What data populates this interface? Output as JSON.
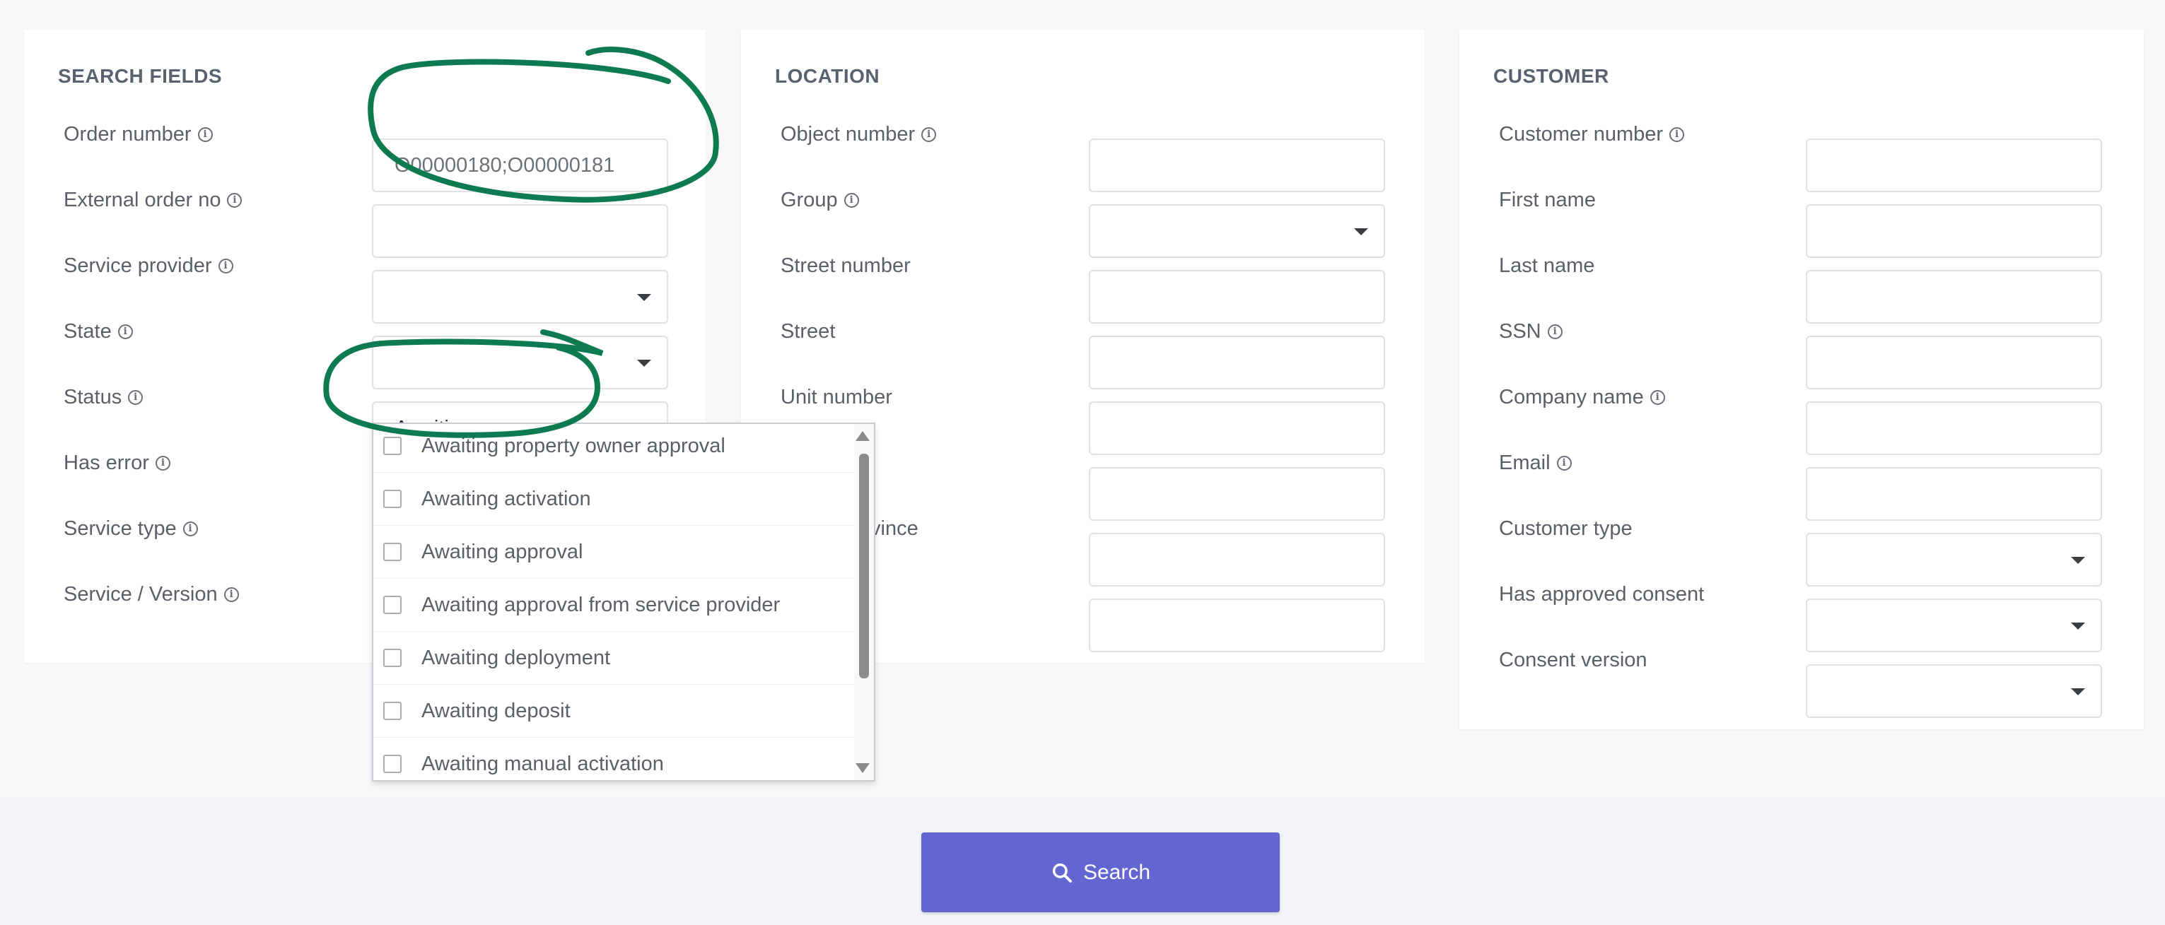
{
  "search_fields": {
    "title": "SEARCH FIELDS",
    "rows": [
      {
        "label": "Order number",
        "value": "O00000180;O00000181"
      },
      {
        "label": "External order no",
        "value": ""
      },
      {
        "label": "Service provider",
        "value": ""
      },
      {
        "label": "State",
        "value": ""
      },
      {
        "label": "Status",
        "value": "Awaiting"
      },
      {
        "label": "Has error"
      },
      {
        "label": "Service type"
      },
      {
        "label": "Service / Version"
      }
    ]
  },
  "location": {
    "title": "LOCATION",
    "rows": [
      {
        "label": "Object number"
      },
      {
        "label": "Group"
      },
      {
        "label": "Street number"
      },
      {
        "label": "Street"
      },
      {
        "label": "Unit number"
      },
      {
        "label": ""
      },
      {
        "label": "vince"
      },
      {
        "label": ""
      }
    ]
  },
  "customer": {
    "title": "CUSTOMER",
    "rows": [
      {
        "label": "Customer number"
      },
      {
        "label": "First name"
      },
      {
        "label": "Last name"
      },
      {
        "label": "SSN"
      },
      {
        "label": "Company name"
      },
      {
        "label": "Email"
      },
      {
        "label": "Customer type"
      },
      {
        "label": "Has approved consent"
      },
      {
        "label": "Consent version"
      }
    ]
  },
  "status_dropdown": {
    "options": [
      "Awaiting property owner approval",
      "Awaiting activation",
      "Awaiting approval",
      "Awaiting approval from service provider",
      "Awaiting deployment",
      "Awaiting deposit",
      "Awaiting manual activation"
    ]
  },
  "footer": {
    "search_label": "Search"
  },
  "colors": {
    "accent": "#6366d1",
    "annotation": "#0e7a52",
    "panel": "#ffffff",
    "background": "#f8f8f9"
  },
  "icons": [
    "info-icon",
    "chevron-down-icon",
    "search-icon",
    "checkbox-icon"
  ]
}
